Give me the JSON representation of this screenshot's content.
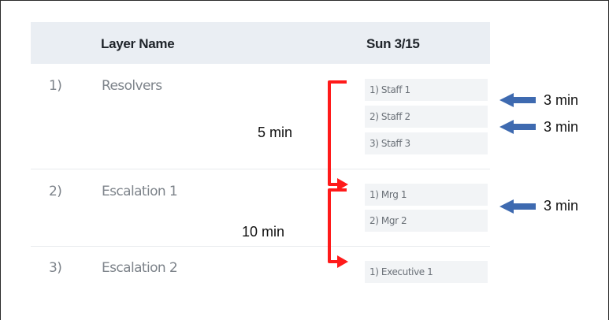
{
  "table": {
    "columns": [
      "Layer Name",
      "Sun 3/15"
    ],
    "rows": [
      {
        "num": "1)",
        "name": "Resolvers",
        "staff": [
          "1) Staff 1",
          "2) Staff 2",
          "3) Staff 3"
        ]
      },
      {
        "num": "2)",
        "name": "Escalation 1",
        "staff": [
          "1) Mrg 1",
          "2) Mgr 2"
        ]
      },
      {
        "num": "3)",
        "name": "Escalation 2",
        "staff": [
          "1) Executive 1"
        ]
      }
    ]
  },
  "annotations": {
    "bracket_labels": [
      "5 min",
      "10 min"
    ],
    "arrow_labels": [
      "3 min",
      "3 min",
      "3 min"
    ],
    "bracket_color": "#ff1a1a",
    "arrow_color": "#3e6ab0"
  }
}
